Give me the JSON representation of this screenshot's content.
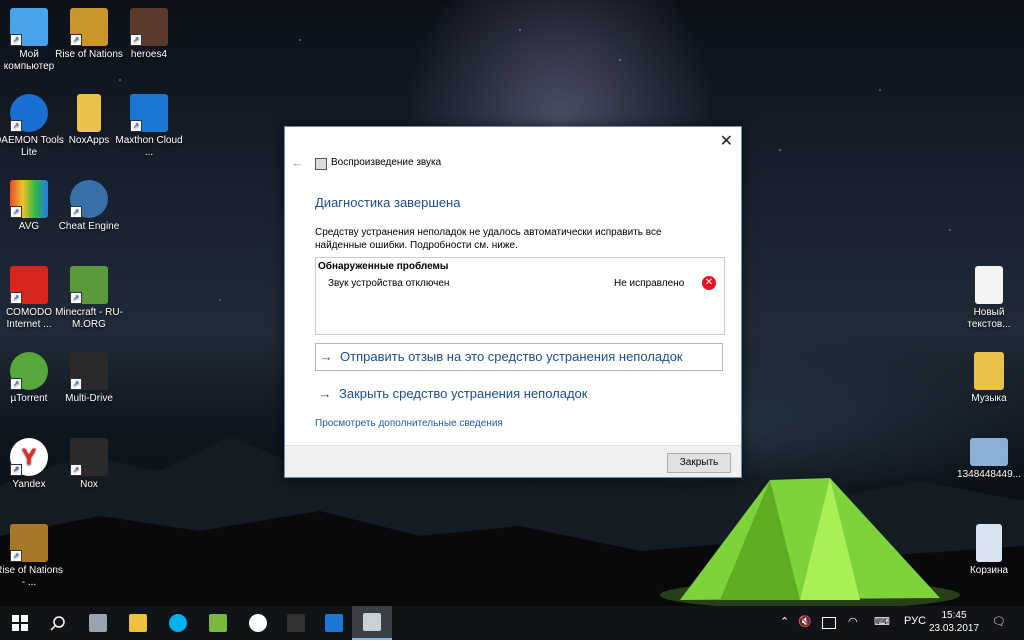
{
  "desktop_icons": [
    {
      "label": "Мой компьютер",
      "icon": "computer-icon",
      "color": "#4aa3e8"
    },
    {
      "label": "Rise of Nations",
      "icon": "rise-of-nations-icon",
      "color": "#c8962a"
    },
    {
      "label": "heroes4",
      "icon": "heroes4-icon",
      "color": "#5a3b2b"
    },
    {
      "label": "DAEMON Tools Lite",
      "icon": "daemon-tools-icon",
      "color": "#1a6fd0"
    },
    {
      "label": "NoxApps",
      "icon": "folder-icon",
      "color": "#e8c24a"
    },
    {
      "label": "Maxthon Cloud ...",
      "icon": "maxthon-icon",
      "color": "#1a78d4"
    },
    {
      "label": "AVG",
      "icon": "avg-icon",
      "color": "#e84a2a"
    },
    {
      "label": "Cheat Engine",
      "icon": "cheat-engine-icon",
      "color": "#3a6ea8"
    },
    {
      "label": "COMODO Internet ...",
      "icon": "comodo-icon",
      "color": "#d8261e"
    },
    {
      "label": "Minecraft - RU-M.ORG",
      "icon": "minecraft-icon",
      "color": "#5a9a3a"
    },
    {
      "label": "µTorrent",
      "icon": "utorrent-icon",
      "color": "#57a83a"
    },
    {
      "label": "Multi-Drive",
      "icon": "nox-multidrive-icon",
      "color": "#2a2a2a"
    },
    {
      "label": "Yandex",
      "icon": "yandex-icon",
      "color": "#ffffff"
    },
    {
      "label": "Nox",
      "icon": "nox-icon",
      "color": "#2a2a2a"
    },
    {
      "label": "Rise of Nations - ...",
      "icon": "rise-of-nations-icon",
      "color": "#a8782a"
    },
    {
      "label": "Новый текстов...",
      "icon": "text-document-icon",
      "color": "#f4f4f4"
    },
    {
      "label": "Музыка",
      "icon": "music-folder-icon",
      "color": "#e8c24a"
    },
    {
      "label": "1348448449...",
      "icon": "image-file-icon",
      "color": "#8ab0d8"
    },
    {
      "label": "Корзина",
      "icon": "recycle-bin-icon",
      "color": "#d8e4f0"
    }
  ],
  "dialog": {
    "title": "Воспроизведение звука",
    "heading": "Диагностика завершена",
    "description": "Средству устранения неполадок не удалось автоматически исправить все найденные ошибки. Подробности см. ниже.",
    "problems_header": "Обнаруженные проблемы",
    "problem_name": "Звук устройства отключен",
    "problem_status": "Не исправлено",
    "cmd_feedback": "Отправить отзыв на это средство устранения неполадок",
    "cmd_close": "Закрыть средство устранения неполадок",
    "more_info": "Просмотреть дополнительные сведения",
    "close_button": "Закрыть"
  },
  "taskbar": {
    "language": "РУС",
    "time": "15:45",
    "date": "23.03.2017",
    "apps": [
      "start-icon",
      "search-icon",
      "task-view-icon",
      "file-explorer-icon",
      "skype-icon",
      "android-app-icon",
      "yandex-browser-icon",
      "nox-icon",
      "maxthon-icon",
      "troubleshooter-icon"
    ]
  },
  "colors": {
    "accent": "#1e4e8c",
    "link": "#1e5aa8",
    "error": "#e81123"
  }
}
